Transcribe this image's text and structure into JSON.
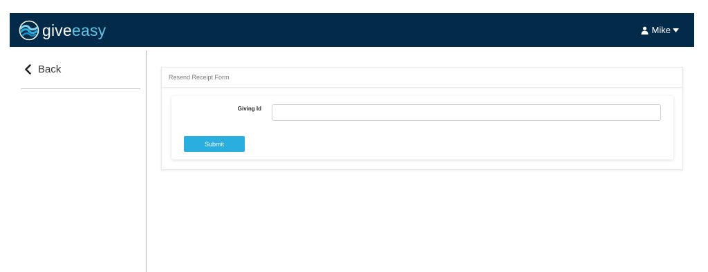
{
  "header": {
    "logo": {
      "give": "give",
      "easy": "easy",
      "colors": {
        "give": "#ffffff",
        "easy": "#5dc4e6"
      }
    },
    "user": {
      "name": "Mike",
      "icon": "user-icon",
      "menu_icon": "caret-down-icon"
    },
    "background": "#042a49"
  },
  "sidebar": {
    "back_label": "Back",
    "back_icon": "chevron-left-icon"
  },
  "main": {
    "panel_title": "Resend Receipt Form",
    "form": {
      "giving_id_label": "Giving Id",
      "giving_id_value": "",
      "giving_id_placeholder": "",
      "submit_label": "Submit",
      "submit_color": "#2aaee0"
    }
  }
}
